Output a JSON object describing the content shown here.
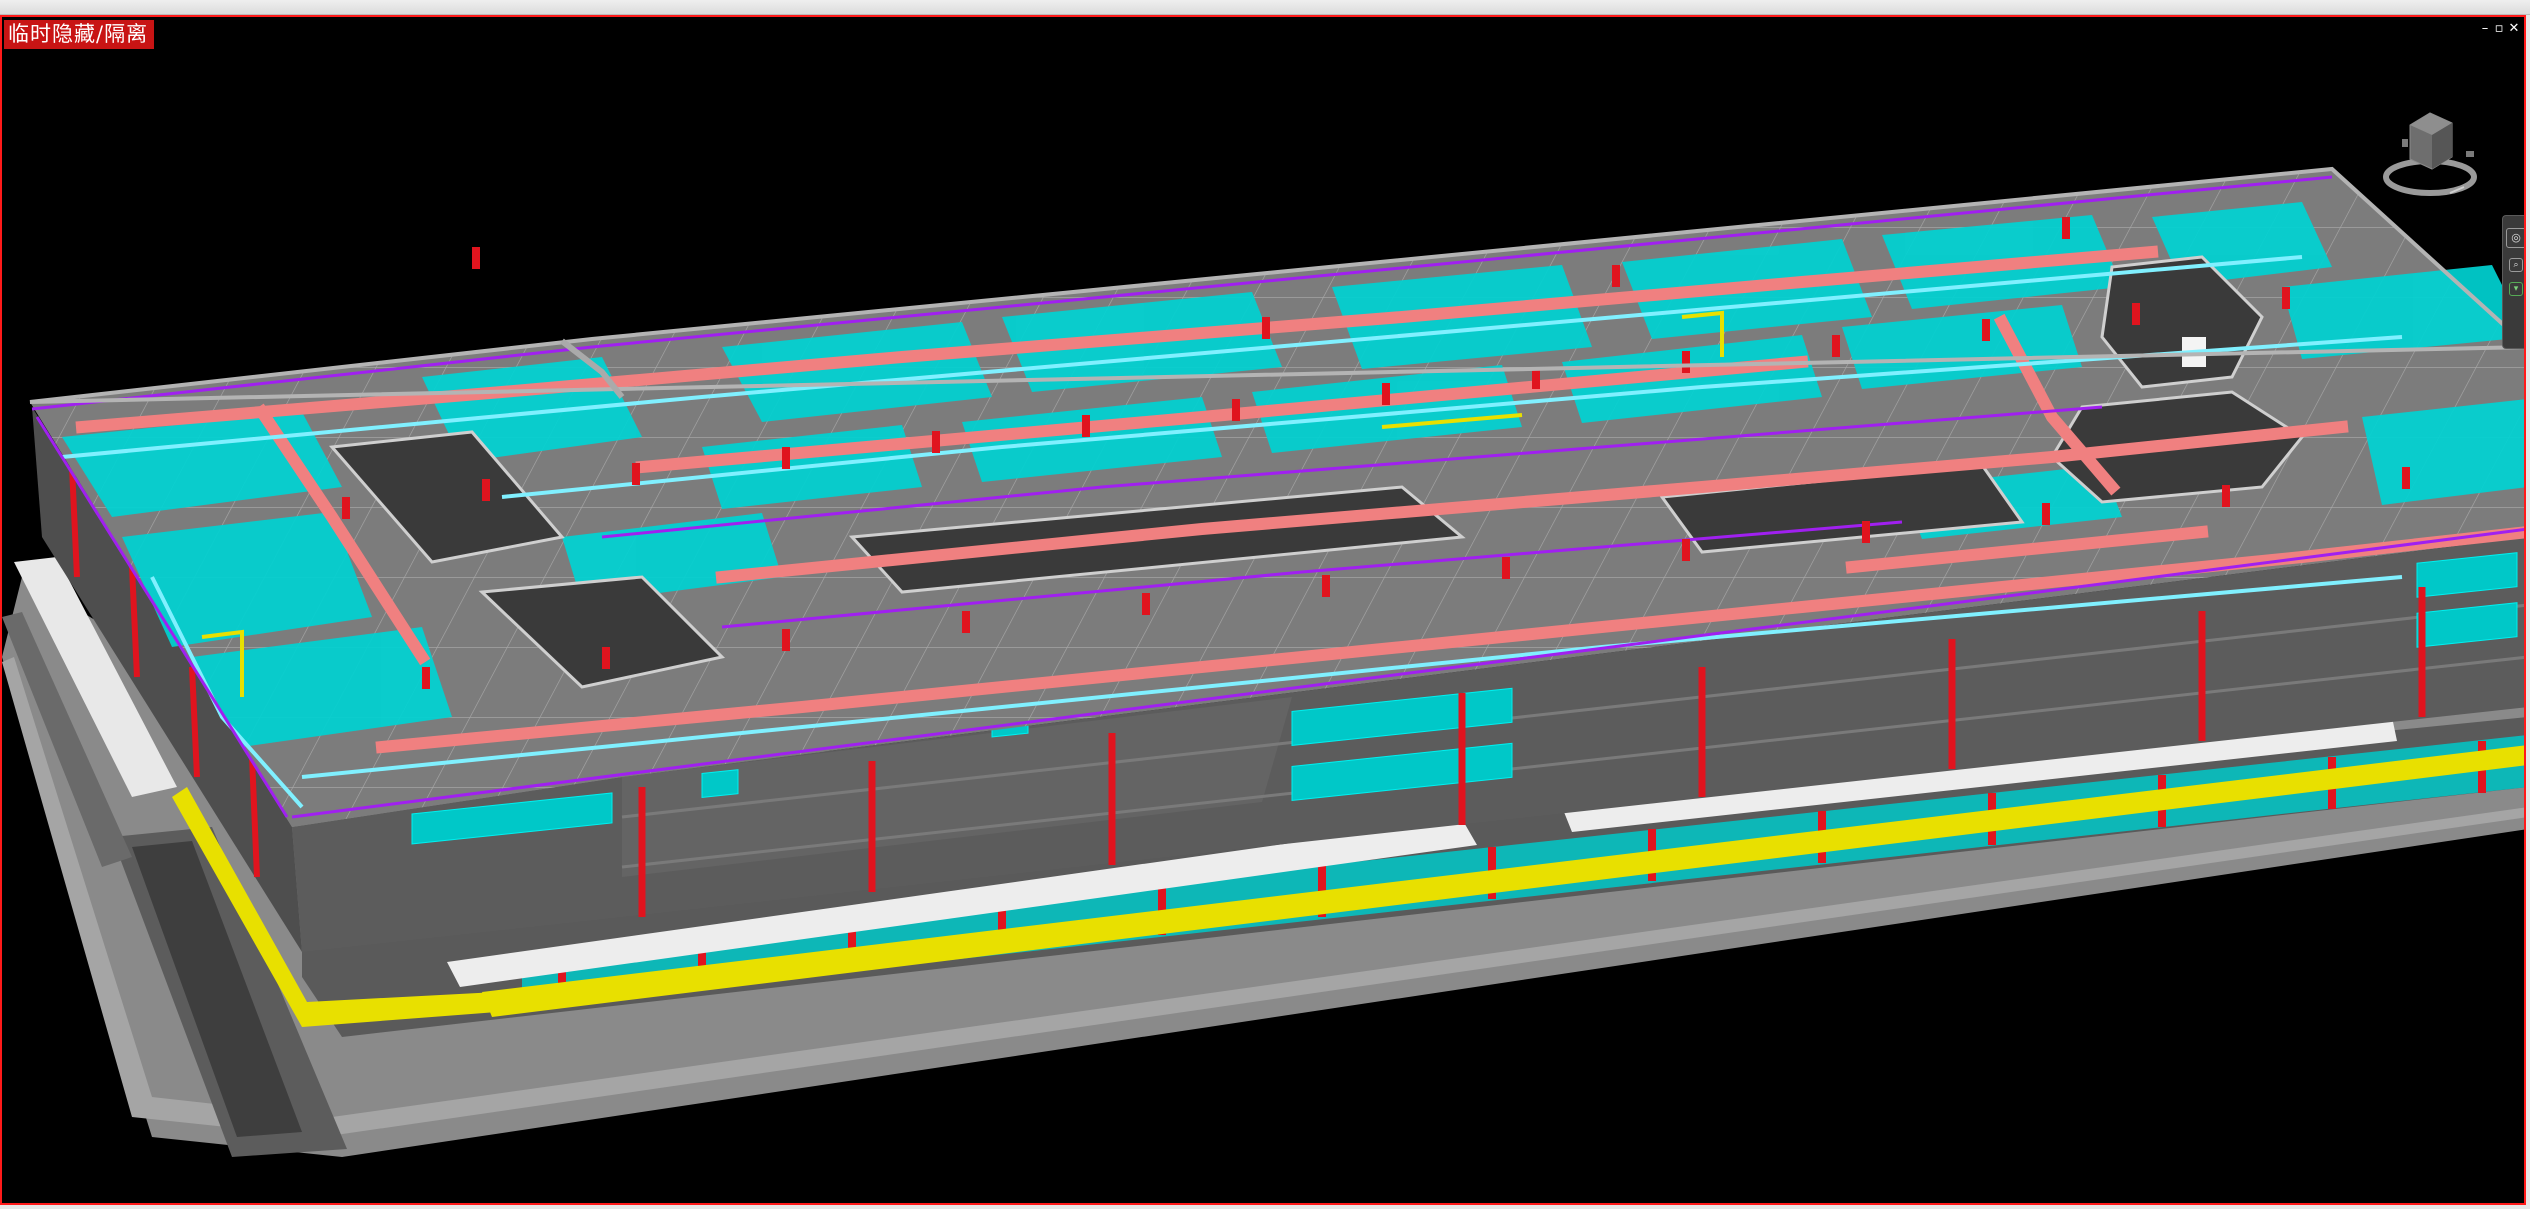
{
  "viewport": {
    "isolate_label": "临时隐藏/隔离",
    "controls": {
      "minimize": "–",
      "restore": "▫",
      "close": "✕"
    }
  },
  "navigation": {
    "viewcube_icon": "viewcube-icon",
    "steering_wheel_icon": "steering-wheel-icon",
    "zoom_icon": "zoom-icon"
  },
  "colors": {
    "isolate_border": "#ff1a1a",
    "background": "#000000",
    "slab": "#8c8c8c",
    "wall": "#585858",
    "room": "#00d2d2",
    "column": "#e0141e",
    "duct": "#f08080",
    "pipe_purple": "#a020f0",
    "pipe_yellow": "#e8e000"
  }
}
